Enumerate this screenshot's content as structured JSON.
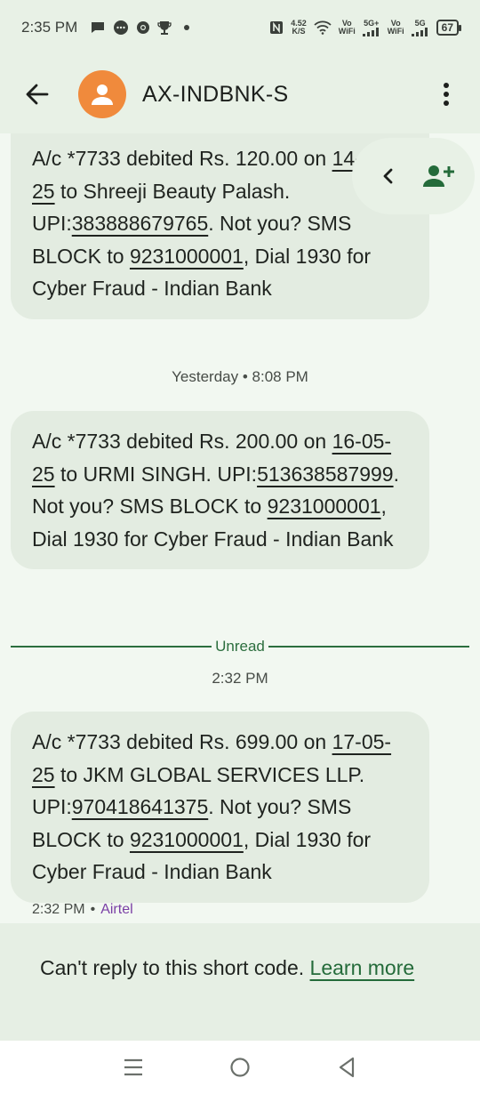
{
  "status_bar": {
    "time": "2:35 PM",
    "net_speed_value": "4.52",
    "net_speed_unit": "K/S",
    "vo_label": "Vo",
    "wifi_label": "WiFi",
    "sig1_label": "5G+",
    "sig2_label": "5G",
    "battery": "67"
  },
  "header": {
    "contact_name": "AX-INDBNK-S",
    "avatar_color": "#f08a3c"
  },
  "messages": [
    {
      "pre": "A/c *7733 debited Rs. 120.00 on ",
      "date": "14-05-25",
      "mid": " to Shreeji Beauty Palash. UPI:",
      "upi": "383888679765",
      "post1": ". Not you? SMS BLOCK to ",
      "phone": "9231000001",
      "post2": ", Dial 1930 for Cyber Fraud - Indian Bank"
    },
    {
      "pre": "A/c *7733 debited Rs. 200.00 on ",
      "date": "16-05-25",
      "mid": " to URMI SINGH. UPI:",
      "upi": "513638587999",
      "post1": ". Not you? SMS BLOCK to ",
      "phone": "9231000001",
      "post2": ", Dial 1930 for Cyber Fraud - Indian Bank"
    },
    {
      "pre": "A/c *7733 debited Rs. 699.00 on ",
      "date": "17-05-25",
      "mid": " to JKM GLOBAL SERVICES LLP. UPI:",
      "upi": "970418641375",
      "post1": ". Not you? SMS BLOCK to ",
      "phone": "9231000001",
      "post2": ", Dial 1930 for Cyber Fraud - Indian Bank"
    }
  ],
  "timestamps": {
    "first": "Yesterday • 8:08 PM",
    "second": "2:32 PM"
  },
  "unread_label": "Unread",
  "last_meta": {
    "time": "2:32 PM",
    "separator": "•",
    "carrier": "Airtel"
  },
  "notice": {
    "text": "Can't reply to this short code. ",
    "link": "Learn more"
  },
  "colors": {
    "accent_green": "#2c6e3e",
    "bubble": "#e3ece1",
    "carrier": "#7a3fa5"
  },
  "icons": [
    "back-arrow-icon",
    "person-icon",
    "more-vert-icon",
    "chevron-left-icon",
    "add-contact-icon",
    "menu-icon",
    "home-circle-icon",
    "back-triangle-icon"
  ]
}
